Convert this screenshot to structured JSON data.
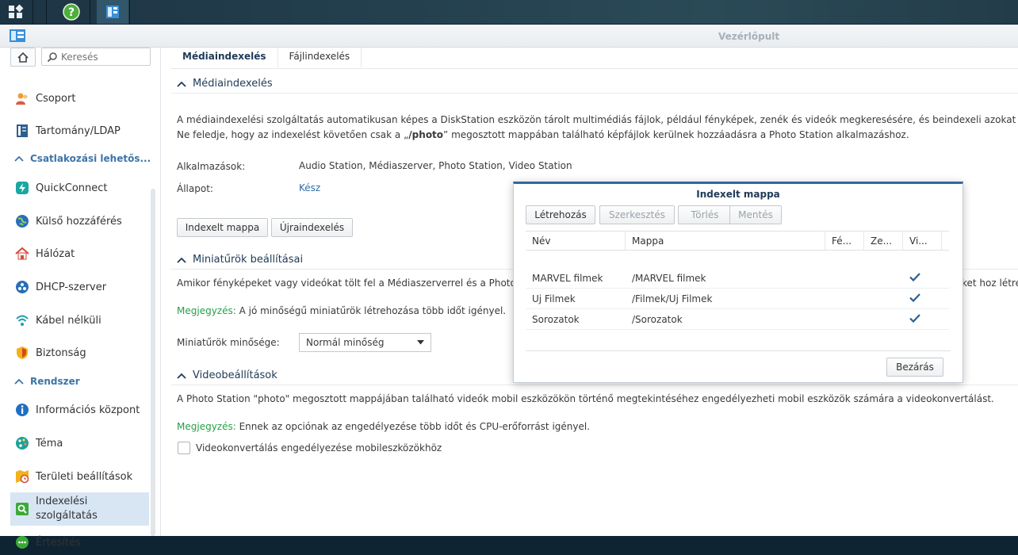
{
  "taskbar": {
    "icons": [
      "main-menu-icon",
      "help-icon",
      "control-panel-icon"
    ]
  },
  "window": {
    "title": "Vezérlőpult"
  },
  "sidebar": {
    "search_placeholder": "Keresés",
    "items": [
      {
        "label": "Csoport",
        "icon": "group-icon"
      },
      {
        "label": "Tartomány/LDAP",
        "icon": "domain-icon"
      },
      {
        "label": "QuickConnect",
        "icon": "quickconnect-icon"
      },
      {
        "label": "Külső hozzáférés",
        "icon": "external-access-icon"
      },
      {
        "label": "Hálózat",
        "icon": "network-icon"
      },
      {
        "label": "DHCP-szerver",
        "icon": "dhcp-icon"
      },
      {
        "label": "Kábel nélküli",
        "icon": "wireless-icon"
      },
      {
        "label": "Biztonság",
        "icon": "security-icon"
      },
      {
        "label": "Információs központ",
        "icon": "info-icon"
      },
      {
        "label": "Téma",
        "icon": "theme-icon"
      },
      {
        "label": "Területi beállítások",
        "icon": "regional-icon"
      },
      {
        "label": "Indexelési szolgáltatás",
        "icon": "indexing-icon"
      },
      {
        "label": "Értesítés",
        "icon": "notification-icon"
      }
    ],
    "sections": {
      "connectivity": "Csatlakozási lehetős...",
      "system": "Rendszer"
    }
  },
  "tabs": [
    {
      "label": "Médiaindexelés",
      "active": true
    },
    {
      "label": "Fájlindexelés",
      "active": false
    }
  ],
  "media": {
    "heading": "Médiaindexelés",
    "desc_line1": "A médiaindexelési szolgáltatás automatikusan képes a DiskStation eszközön tárolt multimédiás fájlok, például fényképek, zenék és videók megkeresésére, és beindexeli azokat a multim",
    "desc_line2_pre": "Ne feledje, hogy az indexelést követően csak a „",
    "desc_line2_bold": "/photo",
    "desc_line2_post": "” megosztott mappában található képfájlok kerülnek hozzáadásra a Photo Station alkalmazáshoz.",
    "apps_label": "Alkalmazások:",
    "apps_value": "Audio Station, Médiaszerver, Photo Station, Video Station",
    "status_label": "Állapot:",
    "status_value": "Kész",
    "btn_indexed_folder": "Indexelt mappa",
    "btn_reindex": "Újraindexelés"
  },
  "thumbs": {
    "heading": "Miniatűrök beállításai",
    "desc_left": "Amikor fényképeket vagy videókat tölt fel a Médiaszerverrel és a Photo S",
    "desc_right": "ket hoz létre",
    "note_label": "Megjegyzés:",
    "note_text": " A jó minőségű miniatűrök létrehozása több időt igényel.",
    "quality_label": "Miniatűrök minősége:",
    "quality_value": "Normál minőség"
  },
  "video": {
    "heading": "Videobeállítások",
    "desc": "A Photo Station \"photo\" megosztott mappájában található videók mobil eszközökön történő megtekintéséhez engedélyezheti mobil eszközök számára a videokonvertálást.",
    "note_label": "Megjegyzés:",
    "note_text": " Ennek az opciónak az engedélyezése több időt és CPU-erőforrást igényel.",
    "checkbox_label": "Videokonvertálás engedélyezése mobileszközökhöz",
    "checkbox_checked": false
  },
  "dialog": {
    "title": "Indexelt mappa",
    "buttons": {
      "create": "Létrehozás",
      "edit": "Szerkesztés",
      "delete": "Törlés",
      "save": "Mentés",
      "close": "Bezárás"
    },
    "columns": [
      "Név",
      "Mappa",
      "Fé...",
      "Ze...",
      "Vi..."
    ],
    "rows": [
      {
        "name": "MARVEL filmek",
        "folder": "/MARVEL filmek",
        "photo": false,
        "music": false,
        "video": true
      },
      {
        "name": "Uj Filmek",
        "folder": "/Filmek/Uj Filmek",
        "photo": false,
        "music": false,
        "video": true
      },
      {
        "name": "Sorozatok",
        "folder": "/Sorozatok",
        "photo": false,
        "music": false,
        "video": true
      }
    ]
  },
  "colors": {
    "accent": "#2d6aa3",
    "note_green": "#24a148",
    "heading_blue": "#1f3a57",
    "section_blue": "#3d74a8",
    "active_bg": "#d8e6f4"
  }
}
